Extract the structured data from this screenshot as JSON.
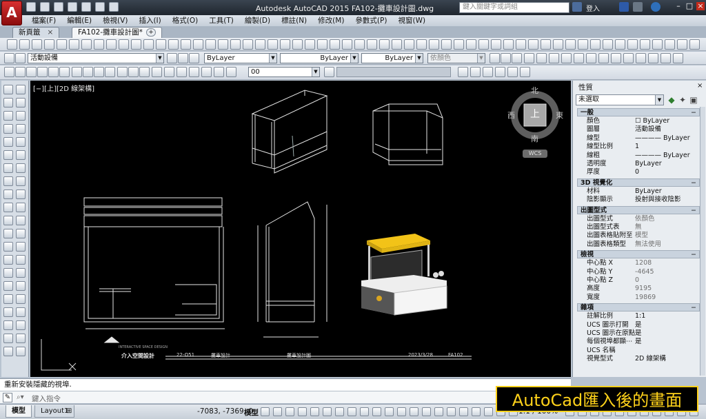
{
  "window": {
    "title": "Autodesk AutoCAD 2015    FA102-攤車設計圖.dwg",
    "search_placeholder": "鍵入關鍵字或詞組",
    "login": "登入",
    "app_button": "A"
  },
  "menubar": {
    "items": [
      "檔案(F)",
      "編輯(E)",
      "檢視(V)",
      "插入(I)",
      "格式(O)",
      "工具(T)",
      "繪製(D)",
      "標註(N)",
      "修改(M)",
      "參數式(P)",
      "視窗(W)"
    ]
  },
  "file_tabs": [
    {
      "label": "新頁籤",
      "active": false
    },
    {
      "label": "FA102-攤車設計圖*",
      "active": true
    }
  ],
  "toolbar2": {
    "layer_combo": "活動設備",
    "color_combo": "ByLayer",
    "linetype_combo": "ByLayer",
    "lineweight_combo": "ByLayer",
    "plotstyle_combo": "依顏色"
  },
  "toolbar3": {
    "dim_combo": "00"
  },
  "viewport": {
    "label": "[−][上][2D 線架構]",
    "compass": {
      "north": "北",
      "south": "南",
      "east": "東",
      "west": "西",
      "top": "上",
      "wcs": "WCS"
    }
  },
  "drawing": {
    "title_strip": [
      "22-O51",
      "攤車設計",
      "攤車設計圖",
      "2023/3/28",
      "FA102"
    ],
    "firm_name": "介入空間設計",
    "firm_sub": "INTERACTIVE SPACE DESIGN"
  },
  "properties": {
    "title": "性質",
    "selection": "未選取",
    "sections": [
      {
        "name": "一般",
        "rows": [
          {
            "label": "顏色",
            "value": "☐ ByLayer"
          },
          {
            "label": "圖層",
            "value": "活動設備"
          },
          {
            "label": "線型",
            "value": "———— ByLayer"
          },
          {
            "label": "線型比例",
            "value": "1"
          },
          {
            "label": "線粗",
            "value": "———— ByLayer"
          },
          {
            "label": "透明度",
            "value": "ByLayer"
          },
          {
            "label": "厚度",
            "value": "0"
          }
        ]
      },
      {
        "name": "3D 視覺化",
        "rows": [
          {
            "label": "材料",
            "value": "ByLayer"
          },
          {
            "label": "陰影顯示",
            "value": "投射與接收陰影"
          }
        ]
      },
      {
        "name": "出圖型式",
        "rows": [
          {
            "label": "出圖型式",
            "value": "依顏色"
          },
          {
            "label": "出圖型式表",
            "value": "無"
          },
          {
            "label": "出圖表格貼附至",
            "value": "模型"
          },
          {
            "label": "出圖表格類型",
            "value": "無法使用"
          }
        ]
      },
      {
        "name": "檢視",
        "rows": [
          {
            "label": "中心點 X",
            "value": "1208"
          },
          {
            "label": "中心點 Y",
            "value": "-4645"
          },
          {
            "label": "中心點 Z",
            "value": "0"
          },
          {
            "label": "高度",
            "value": "9195"
          },
          {
            "label": "寬度",
            "value": "19869"
          }
        ]
      },
      {
        "name": "雜項",
        "rows": [
          {
            "label": "註解比例",
            "value": "1:1"
          },
          {
            "label": "UCS 圖示打開",
            "value": "是"
          },
          {
            "label": "UCS 圖示在原點",
            "value": "是"
          },
          {
            "label": "每個視埠都顯⋯",
            "value": "是"
          },
          {
            "label": "UCS 名稱",
            "value": ""
          },
          {
            "label": "視覺型式",
            "value": "2D 線架構"
          }
        ]
      }
    ]
  },
  "command": {
    "history": "重新安裝隱藏的視埠.",
    "prompt": "鍵入指令"
  },
  "status": {
    "tabs": [
      "模型",
      "Layout1"
    ],
    "coords": "-7083, -7369, 0",
    "model": "模型",
    "scale": "1:1 / 100%"
  },
  "overlay_caption": "AutoCad匯入後的畫面",
  "colors": {
    "awning": "#f2c318",
    "canvas": "#000000",
    "accent": "#c81e1e"
  }
}
